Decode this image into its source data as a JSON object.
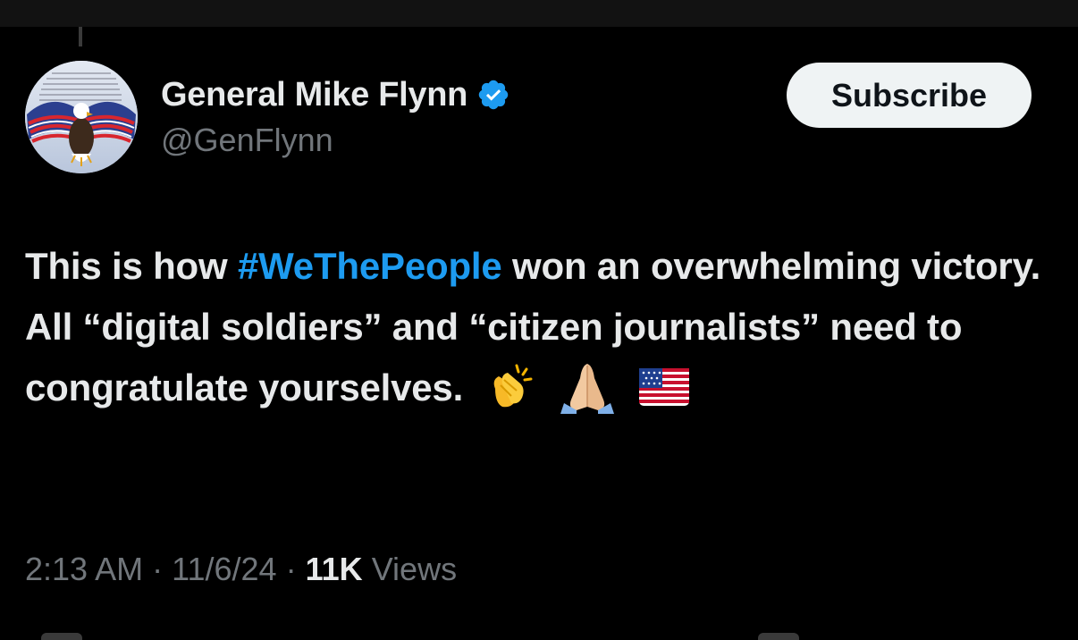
{
  "author": {
    "display_name": "General Mike Flynn",
    "handle": "@GenFlynn",
    "verified_icon": "verified-badge-icon",
    "avatar_icon": "eagle-flag-avatar"
  },
  "actions": {
    "subscribe_label": "Subscribe"
  },
  "tweet": {
    "text_before": "This is how ",
    "hashtag": "#WeThePeople",
    "text_after": " won an overwhelming victory. All “digital soldiers” and “citizen journalists” need to congratulate yourselves.",
    "emojis": [
      "clapping-hands-icon",
      "folded-hands-icon",
      "us-flag-icon"
    ]
  },
  "meta": {
    "time": "2:13 AM",
    "separator": "·",
    "date": "11/6/24",
    "views_count": "11K",
    "views_label": "Views"
  },
  "colors": {
    "background": "#000000",
    "text": "#e7e9ea",
    "secondary_text": "#71767b",
    "accent": "#1d9bf0",
    "button_bg": "#eff3f4"
  }
}
